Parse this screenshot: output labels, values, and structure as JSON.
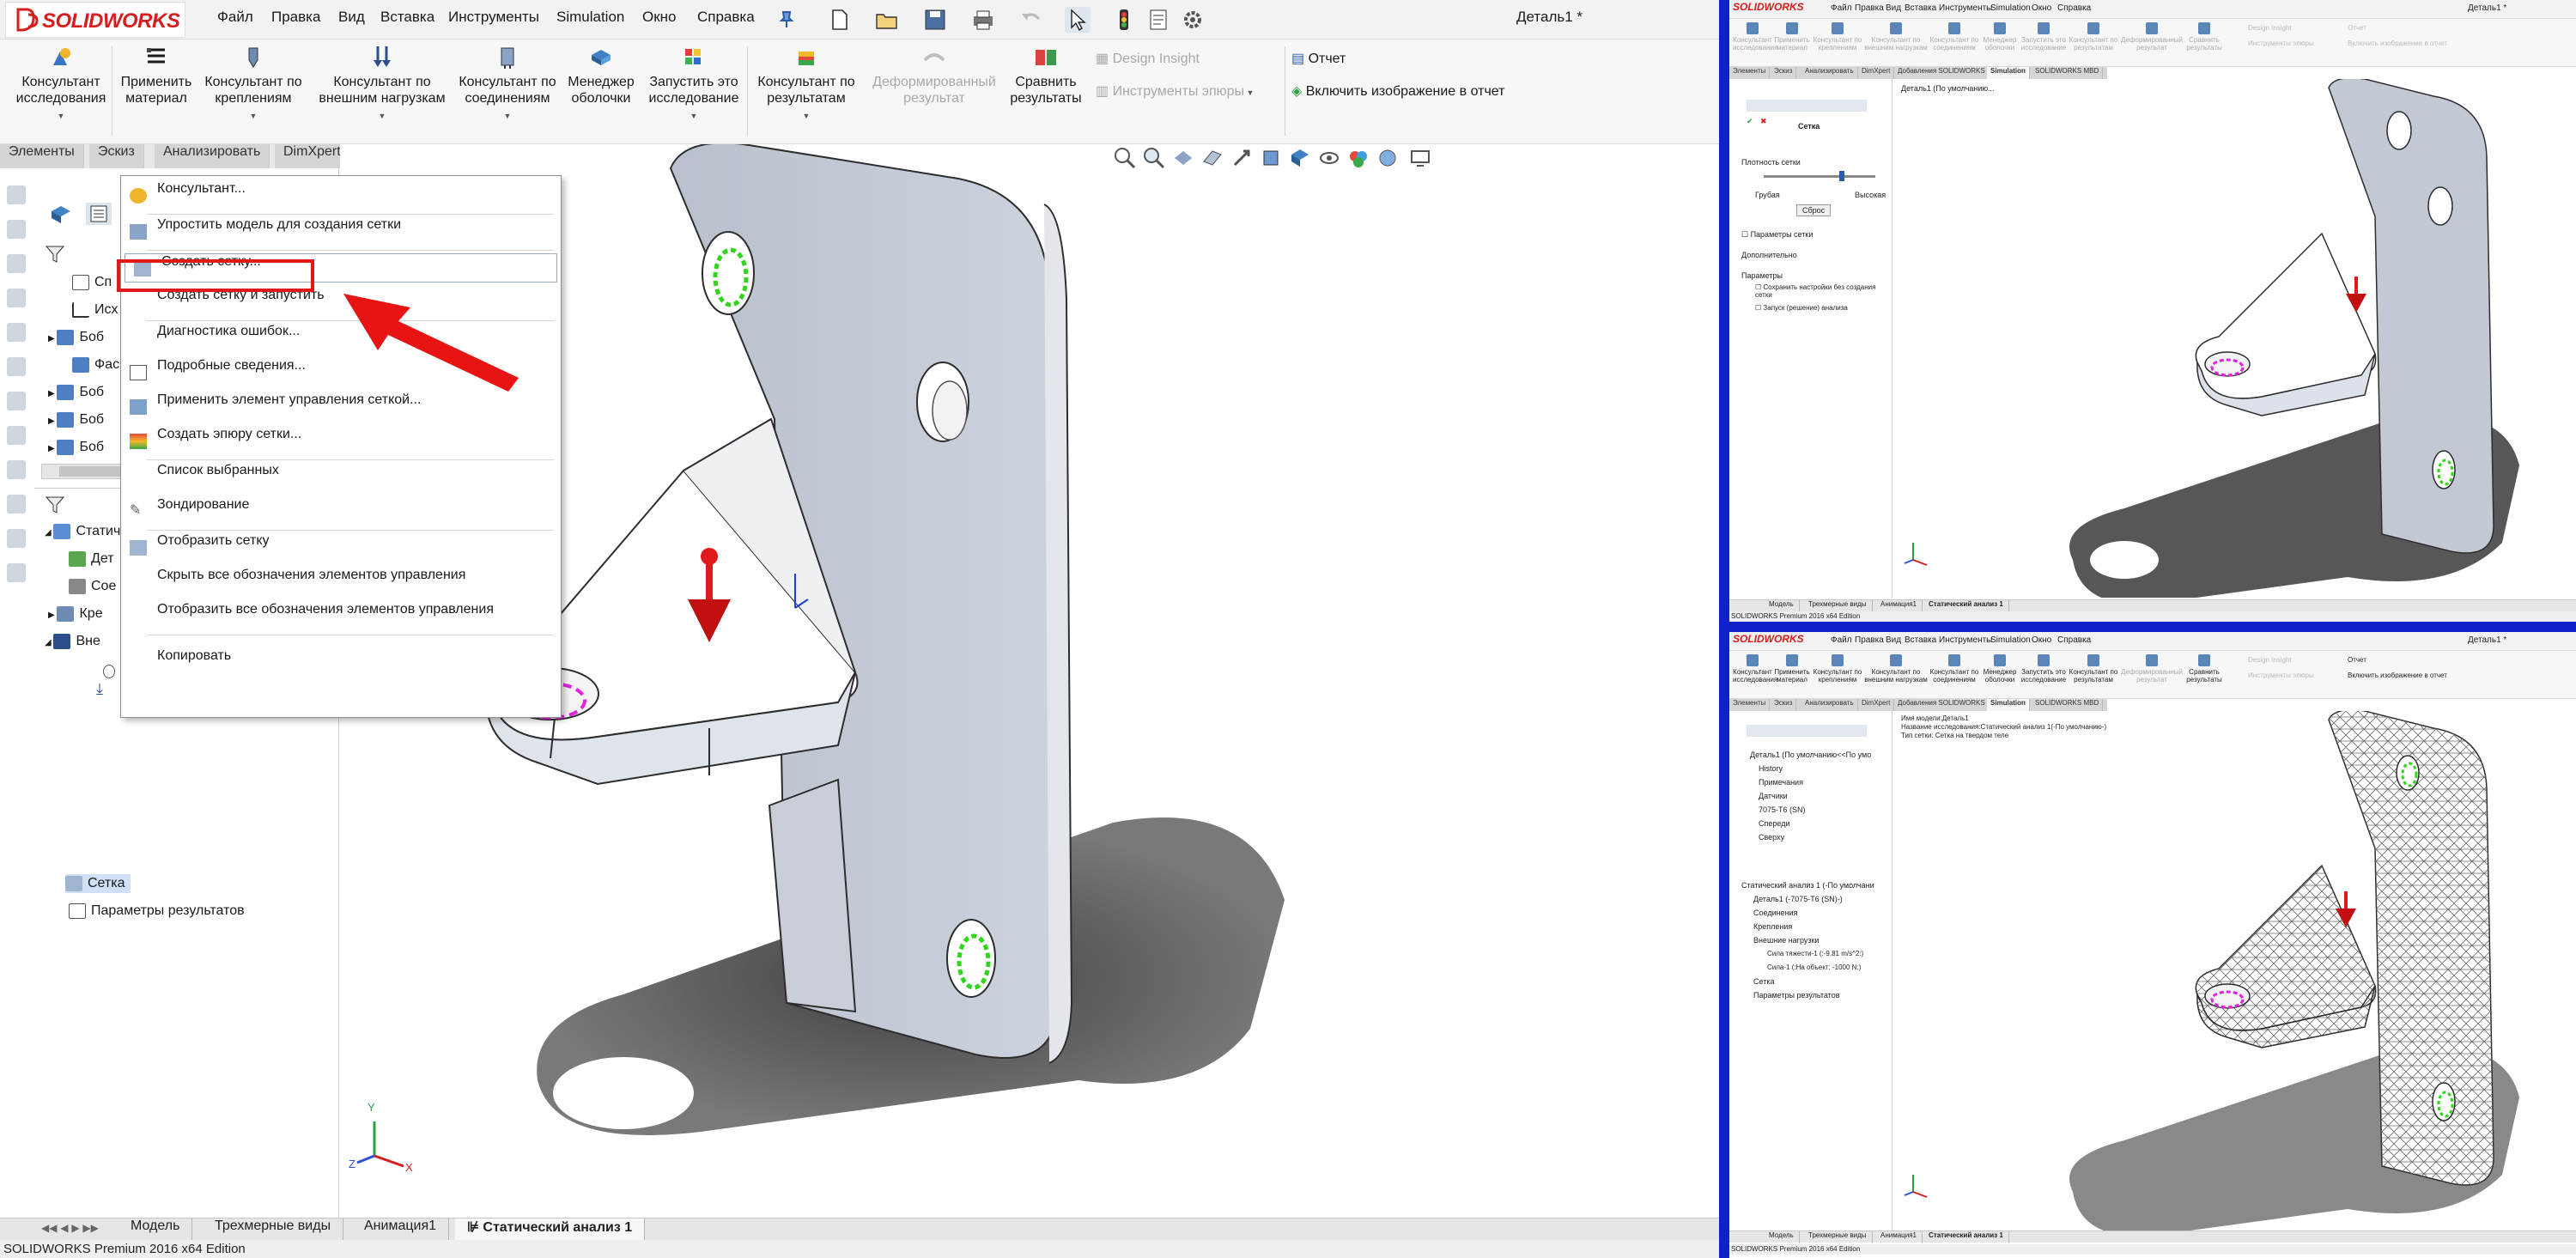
{
  "app": {
    "name": "SOLIDWORKS",
    "doc_title": "Деталь1 *"
  },
  "colors": {
    "accent_red": "#e11818",
    "divider_blue": "#0d22c9",
    "solidworks_red": "#d61e1e"
  },
  "menu": [
    "Файл",
    "Правка",
    "Вид",
    "Вставка",
    "Инструменты",
    "Simulation",
    "Окно",
    "Справка"
  ],
  "toolbar_icons": [
    "new-icon",
    "open-icon",
    "save-icon",
    "print-icon",
    "undo-icon",
    "select-icon",
    "rebuild-icon",
    "file-properties-icon",
    "options-icon"
  ],
  "commands": [
    {
      "label": "Консультант\nисследования",
      "icon": "study-advisor-icon",
      "disabled": false
    },
    {
      "label": "Применить\nматериал",
      "icon": "apply-material-icon",
      "disabled": false
    },
    {
      "label": "Консультант по\nкреплениям",
      "icon": "fixtures-advisor-icon",
      "disabled": false
    },
    {
      "label": "Консультант по\nвнешним нагрузкам",
      "icon": "external-loads-advisor-icon",
      "disabled": false
    },
    {
      "label": "Консультант по\nсоединениям",
      "icon": "connections-advisor-icon",
      "disabled": false
    },
    {
      "label": "Менеджер\nоболочки",
      "icon": "shell-manager-icon",
      "disabled": false
    },
    {
      "label": "Запустить это\nисследование",
      "icon": "run-study-icon",
      "disabled": false
    },
    {
      "label": "Консультант по\nрезультатам",
      "icon": "results-advisor-icon",
      "disabled": false
    },
    {
      "label": "Деформированный\nрезультат",
      "icon": "deformed-result-icon",
      "disabled": true
    },
    {
      "label": "Сравнить\nрезультаты",
      "icon": "compare-results-icon",
      "disabled": false
    }
  ],
  "design_insight": {
    "label": "Design Insight",
    "plot_tools": "Инструменты эпюры"
  },
  "report": {
    "label": "Отчет",
    "include_image": "Включить изображение в отчет"
  },
  "tabs": [
    "Элементы",
    "Эскиз",
    "Анализировать",
    "DimXpert",
    "Добавления SOLIDWORKS",
    "Simulation",
    "SOLIDWORKS MBD"
  ],
  "active_tab": "Simulation",
  "tree": {
    "rows_top": [
      "Сп",
      "Исх",
      "Боб",
      "Фас",
      "Боб",
      "Боб",
      "Боб"
    ],
    "study_rows": [
      "Статиче",
      "Дет",
      "Сое",
      "Кре",
      "Вне"
    ],
    "mesh": "Сетка",
    "results": "Параметры результатов"
  },
  "context_menu": [
    {
      "label": "Консультант...",
      "icon": "advisor-icon"
    },
    {
      "label": "Упростить модель для создания сетки",
      "icon": "simplify-icon"
    },
    {
      "label": "Создать сетку...",
      "icon": "mesh-icon",
      "highlighted": true
    },
    {
      "label": "Создать сетку и запустить",
      "icon": ""
    },
    {
      "label": "Диагностика ошибок...",
      "icon": ""
    },
    {
      "label": "Подробные сведения...",
      "icon": "details-icon"
    },
    {
      "label": "Применить элемент управления сеткой...",
      "icon": "mesh-control-icon"
    },
    {
      "label": "Создать эпюру сетки...",
      "icon": "mesh-plot-icon"
    },
    {
      "label": "Список выбранных",
      "icon": ""
    },
    {
      "label": "Зондирование",
      "icon": "probe-icon"
    },
    {
      "label": "Отобразить сетку",
      "icon": "show-mesh-icon"
    },
    {
      "label": "Скрыть все обозначения элементов управления",
      "icon": ""
    },
    {
      "label": "Отобразить все обозначения элементов управления",
      "icon": ""
    },
    {
      "label": "Копировать",
      "icon": ""
    }
  ],
  "bottom_tabs": [
    "Модель",
    "Трехмерные виды",
    "Анимация1",
    "Статический анализ 1"
  ],
  "status": "SOLIDWORKS Premium 2016 x64 Edition",
  "axis_labels": {
    "x": "X",
    "y": "Y",
    "z": "Z"
  },
  "win_tr": {
    "title": "Деталь1 *",
    "tree_title": "Деталь1 (По умолчанию...",
    "panel_title": "Сетка",
    "density_label": "Плотность сетки",
    "coarse": "Грубая",
    "fine": "Высокая",
    "reset": "Сброс",
    "mesh_params": "Параметры сетки",
    "advanced": "Дополнительно",
    "options": "Параметры",
    "save_without_mesh": "Сохранить настройки без создания сетки",
    "run_after": "Запуск (решение) анализа",
    "bottom_tabs": [
      "Модель",
      "Трехмерные виды",
      "Анимация1",
      "Статический анализ 1"
    ],
    "status": "SOLIDWORKS Premium 2016 x64 Edition"
  },
  "win_br": {
    "title": "Деталь1 *",
    "info": [
      "Имя модели:Деталь1",
      "Название исследования:Статический анализ 1(-По умолчанию-)",
      "Тип сетки: Сетка на твердом теле"
    ],
    "tree": [
      "Деталь1 (По умолчанию<<По умо",
      "History",
      "Примечания",
      "Датчики",
      "7075-T6 (SN)",
      "Спереди",
      "Сверху"
    ],
    "study": [
      "Статический анализ 1 (-По умолчани",
      "Деталь1 (-7075-T6 (SN)-)",
      "Соединения",
      "Крепления",
      "Внешние нагрузки",
      "Сила тяжести-1 (:-9.81 m/s^2:)",
      "Сила-1 (:На объект: -1000 N:)",
      "Сетка",
      "Параметры результатов"
    ],
    "bottom_tabs": [
      "Модель",
      "Трехмерные виды",
      "Анимация1",
      "Статический анализ 1"
    ],
    "status": "SOLIDWORKS Premium 2016 x64 Edition"
  }
}
